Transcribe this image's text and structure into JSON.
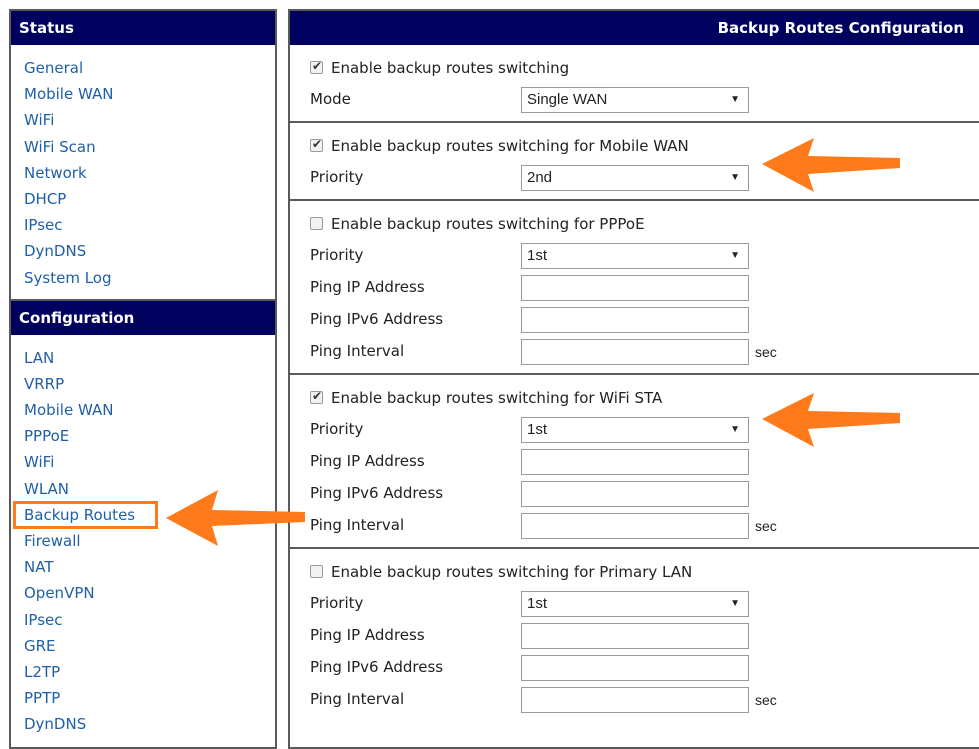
{
  "sidebar": {
    "status_header": "Status",
    "status_items": [
      "General",
      "Mobile WAN",
      "WiFi",
      "WiFi Scan",
      "Network",
      "DHCP",
      "IPsec",
      "DynDNS",
      "System Log"
    ],
    "config_header": "Configuration",
    "config_items": [
      "LAN",
      "VRRP",
      "Mobile WAN",
      "PPPoE",
      "WiFi",
      "WLAN",
      "Backup Routes",
      "Firewall",
      "NAT",
      "OpenVPN",
      "IPsec",
      "GRE",
      "L2TP",
      "PPTP",
      "DynDNS"
    ],
    "active_item": "Backup Routes"
  },
  "main": {
    "title": "Backup Routes Configuration",
    "general": {
      "enable_label": "Enable backup routes switching",
      "enabled": true,
      "mode_label": "Mode",
      "mode_value": "Single WAN"
    },
    "mobile_wan": {
      "enable_label": "Enable backup routes switching for Mobile WAN",
      "enabled": true,
      "priority_label": "Priority",
      "priority_value": "2nd"
    },
    "pppoe": {
      "enable_label": "Enable backup routes switching for PPPoE",
      "enabled": false,
      "priority_label": "Priority",
      "priority_value": "1st",
      "ping_ip_label": "Ping IP Address",
      "ping_ip_value": "",
      "ping_ipv6_label": "Ping IPv6 Address",
      "ping_ipv6_value": "",
      "ping_interval_label": "Ping Interval",
      "ping_interval_value": "",
      "unit": "sec"
    },
    "wifi_sta": {
      "enable_label": "Enable backup routes switching for WiFi STA",
      "enabled": true,
      "priority_label": "Priority",
      "priority_value": "1st",
      "ping_ip_label": "Ping IP Address",
      "ping_ip_value": "",
      "ping_ipv6_label": "Ping IPv6 Address",
      "ping_ipv6_value": "",
      "ping_interval_label": "Ping Interval",
      "ping_interval_value": "",
      "unit": "sec"
    },
    "primary_lan": {
      "enable_label": "Enable backup routes switching for Primary LAN",
      "enabled": false,
      "priority_label": "Priority",
      "priority_value": "1st",
      "ping_ip_label": "Ping IP Address",
      "ping_ip_value": "",
      "ping_ipv6_label": "Ping IPv6 Address",
      "ping_ipv6_value": "",
      "ping_interval_label": "Ping Interval",
      "ping_interval_value": "",
      "unit": "sec"
    }
  },
  "colors": {
    "header_bg": "#00005e",
    "link": "#1f5fa8",
    "highlight": "#ff7a1a"
  }
}
